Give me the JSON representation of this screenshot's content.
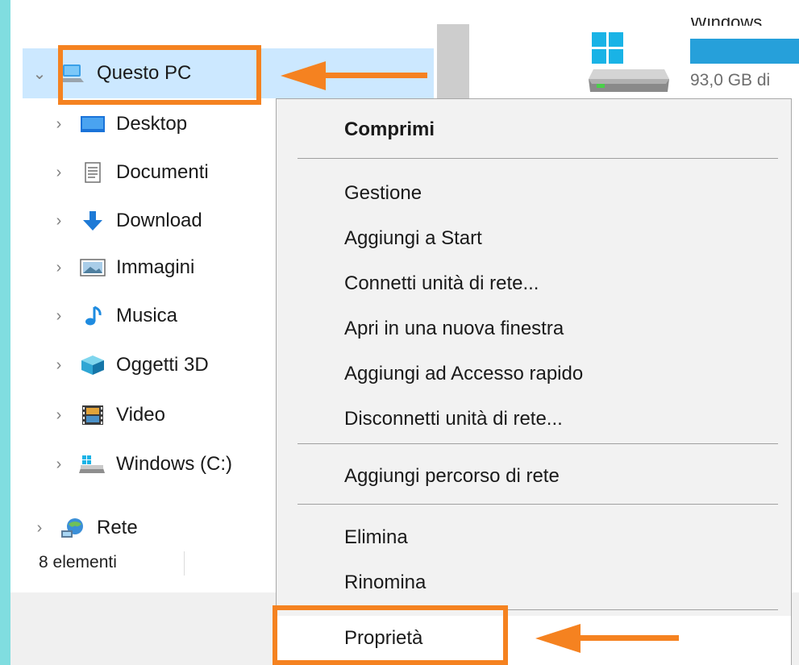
{
  "tree": {
    "root": {
      "label": "Questo PC",
      "icon": "computer-icon"
    },
    "items": [
      {
        "label": "Desktop",
        "icon": "desktop-icon"
      },
      {
        "label": "Documenti",
        "icon": "document-icon"
      },
      {
        "label": "Download",
        "icon": "download-icon"
      },
      {
        "label": "Immagini",
        "icon": "pictures-icon"
      },
      {
        "label": "Musica",
        "icon": "music-icon"
      },
      {
        "label": "Oggetti 3D",
        "icon": "cube-3d-icon"
      },
      {
        "label": "Video",
        "icon": "video-icon"
      },
      {
        "label": "Windows  (C:)",
        "icon": "windows-drive-icon"
      }
    ],
    "network": {
      "label": "Rete",
      "icon": "network-icon"
    }
  },
  "status": {
    "count": "8 elementi"
  },
  "drive": {
    "name_partial": "Windows",
    "free_text": "93,0 GB di",
    "bar_color": "#26a0da"
  },
  "context_menu": {
    "items": [
      {
        "label": "Comprimi",
        "bold": true
      },
      {
        "label": "Gestione"
      },
      {
        "label": "Aggiungi a Start"
      },
      {
        "label": "Connetti unità di rete..."
      },
      {
        "label": "Apri in una nuova finestra"
      },
      {
        "label": "Aggiungi ad Accesso rapido"
      },
      {
        "label": "Disconnetti unità di rete..."
      },
      {
        "label": "Aggiungi percorso di rete"
      },
      {
        "label": "Elimina"
      },
      {
        "label": "Rinomina"
      },
      {
        "label": "Proprietà"
      }
    ]
  },
  "colors": {
    "accent_orange": "#f58220",
    "selection": "#cce8ff",
    "left_strip": "#80dde0"
  }
}
